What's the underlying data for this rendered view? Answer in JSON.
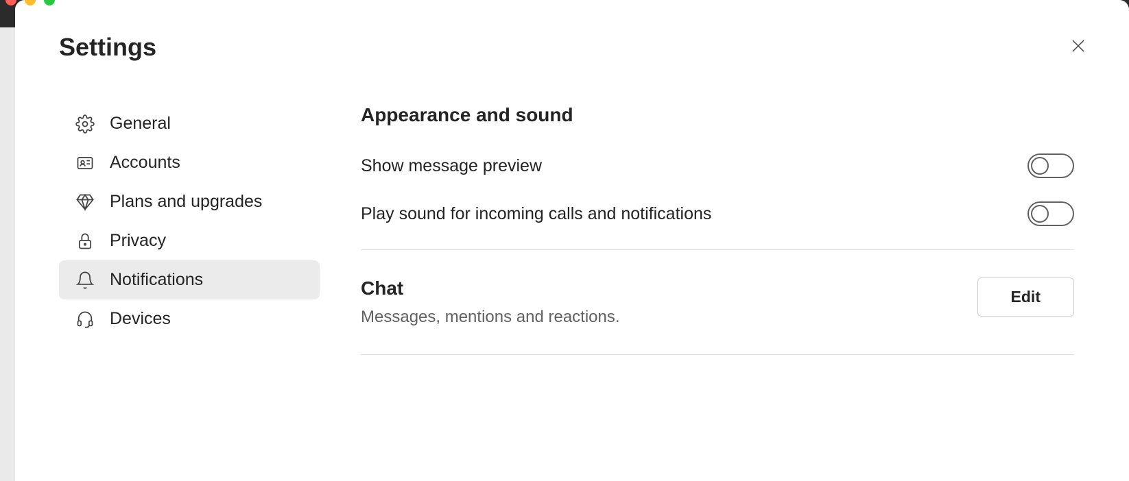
{
  "header": {
    "title": "Settings"
  },
  "sidebar": {
    "items": [
      {
        "label": "General",
        "active": false
      },
      {
        "label": "Accounts",
        "active": false
      },
      {
        "label": "Plans and upgrades",
        "active": false
      },
      {
        "label": "Privacy",
        "active": false
      },
      {
        "label": "Notifications",
        "active": true
      },
      {
        "label": "Devices",
        "active": false
      }
    ]
  },
  "content": {
    "section1": {
      "title": "Appearance and sound",
      "settings": [
        {
          "label": "Show message preview",
          "value": false
        },
        {
          "label": "Play sound for incoming calls and notifications",
          "value": false
        }
      ]
    },
    "section2": {
      "title": "Chat",
      "description": "Messages, mentions and reactions.",
      "action_label": "Edit"
    }
  }
}
